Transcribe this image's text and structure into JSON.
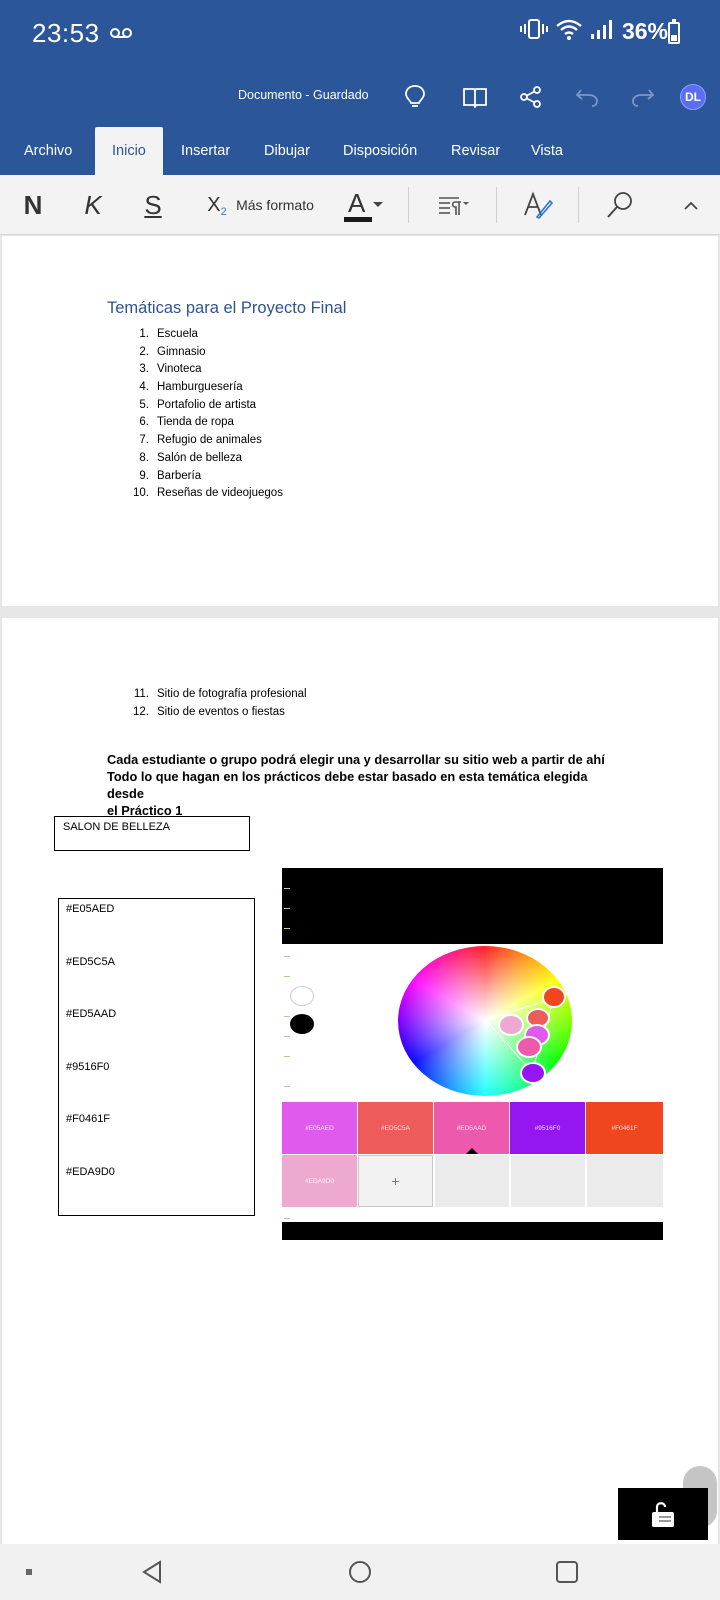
{
  "status_bar": {
    "time": "23:53",
    "battery": "36%",
    "battery_level": 0.36,
    "icons": [
      "voicemail-icon",
      "vibrate-icon",
      "wifi-icon",
      "signal-icon",
      "battery-icon"
    ]
  },
  "title_bar": {
    "doc_title": "Documento - Guardado",
    "avatar_initials": "DL",
    "avatar_color": "#5b6df0",
    "icons": [
      "lightbulb-icon",
      "book-icon",
      "share-icon",
      "undo-icon",
      "redo-icon"
    ]
  },
  "tabs": [
    {
      "label": "Archivo"
    },
    {
      "label": "Inicio",
      "active": true
    },
    {
      "label": "Insertar"
    },
    {
      "label": "Dibujar"
    },
    {
      "label": "Disposición"
    },
    {
      "label": "Revisar"
    },
    {
      "label": "Vista"
    }
  ],
  "ribbon": {
    "bold": "N",
    "italic": "K",
    "underline": "S",
    "subscript": "X",
    "subscript_index": "2",
    "more_format": "Más formato",
    "font_color_letter": "A",
    "font_color": "#1a1a1a"
  },
  "document": {
    "heading": "Temáticas para el Proyecto Final",
    "topics_page1": [
      {
        "num": "1.",
        "text": "Escuela"
      },
      {
        "num": "2.",
        "text": "Gimnasio"
      },
      {
        "num": "3.",
        "text": "Vinoteca"
      },
      {
        "num": "4.",
        "text": "Hamburguesería"
      },
      {
        "num": "5.",
        "text": "Portafolio de artista"
      },
      {
        "num": "6.",
        "text": "Tienda de ropa"
      },
      {
        "num": "7.",
        "text": "Refugio de animales"
      },
      {
        "num": "8.",
        "text": "Salón de belleza"
      },
      {
        "num": "9.",
        "text": "Barbería"
      },
      {
        "num": "10.",
        "text": "Reseñas de videojuegos"
      }
    ],
    "topics_page2": [
      {
        "num": "11.",
        "text": "Sitio de fotografía profesional"
      },
      {
        "num": "12.",
        "text": "Sitio de eventos o fiestas"
      }
    ],
    "paragraph_lines": [
      "Cada estudiante o grupo podrá elegir una y desarrollar su sitio web a partir de ahí",
      "Todo lo que hagan en los prácticos debe estar basado en esta temática elegida desde",
      "el Práctico 1"
    ],
    "chosen_topic": "SALON DE BELLEZA",
    "color_codes": [
      "#E05AED",
      "#ED5C5A",
      "#ED5AAD",
      "#9516F0",
      "#F0461F",
      "#EDA9D0"
    ]
  },
  "palette": {
    "swatches": [
      {
        "label": "#E05AED",
        "color": "#e05aed"
      },
      {
        "label": "#ED5C5A",
        "color": "#ed5c5a"
      },
      {
        "label": "#ED5AAD",
        "color": "#ed5aad"
      },
      {
        "label": "#9516F0",
        "color": "#9516f0"
      },
      {
        "label": "#F0461F",
        "color": "#f0461f"
      },
      {
        "label": "#EDA9D0",
        "color": "#eda9d0"
      }
    ],
    "add_label": "+"
  },
  "colors": {
    "app_blue": "#2b579a",
    "heading_blue": "#2f5496",
    "ribbon_bg": "#f3f3f3"
  }
}
